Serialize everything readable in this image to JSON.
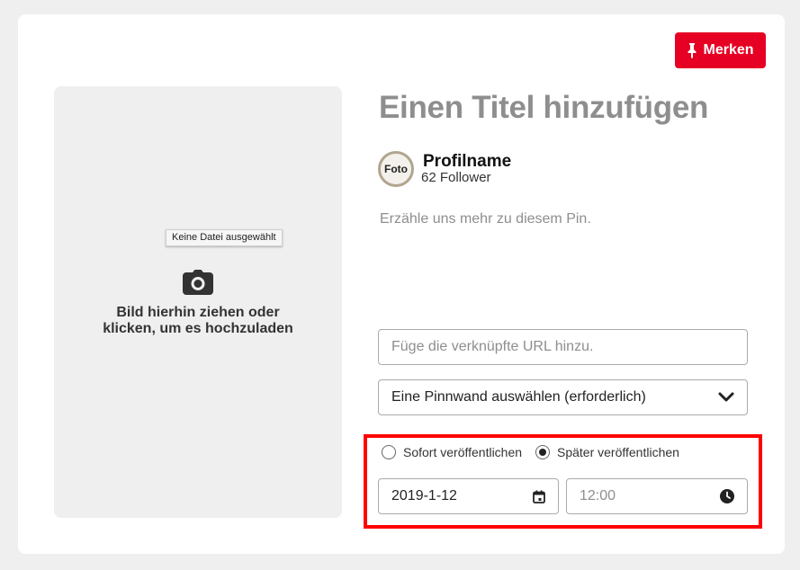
{
  "header": {
    "save_label": "Merken"
  },
  "upload": {
    "tooltip": "Keine Datei ausgewählt",
    "instruction_line1": "Bild hierhin ziehen oder",
    "instruction_line2": "klicken, um es hochzuladen"
  },
  "pin": {
    "title_placeholder": "Einen Titel hinzufügen",
    "description_placeholder": "Erzähle uns mehr zu diesem Pin."
  },
  "profile": {
    "avatar_text": "Foto",
    "name": "Profilname",
    "followers": "62 Follower"
  },
  "form": {
    "url_placeholder": "Füge die verknüpfte URL hinzu.",
    "board_select_value": "Eine Pinnwand auswählen (erforderlich)"
  },
  "publish": {
    "now_label": "Sofort veröffentlichen",
    "later_label": "Später veröffentlichen",
    "selected": "later",
    "date_value": "2019-1-12",
    "time_placeholder": "12:00"
  },
  "colors": {
    "accent": "#e60023",
    "highlight": "#ff0000"
  }
}
